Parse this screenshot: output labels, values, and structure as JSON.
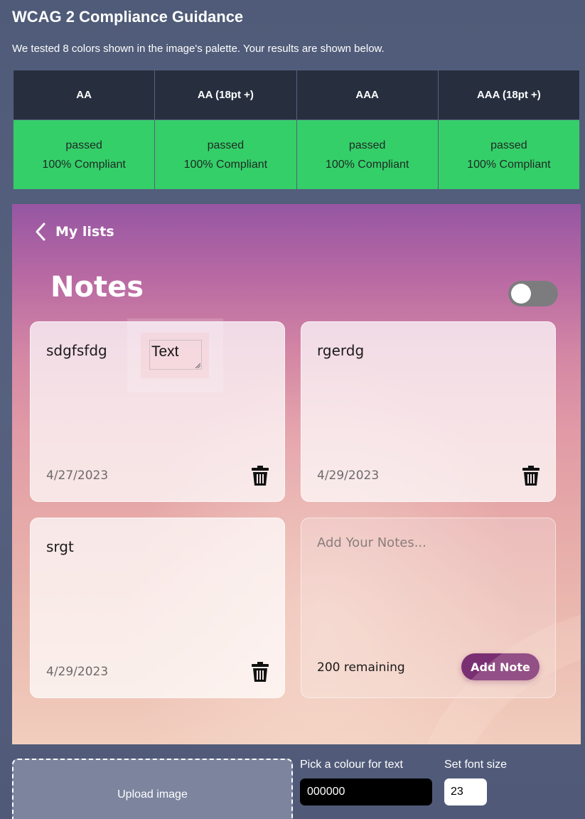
{
  "header": {
    "title": "WCAG 2 Compliance Guidance",
    "subtitle": "We tested 8 colors shown in the image's palette. Your results are shown below."
  },
  "compliance": {
    "columns": [
      "AA",
      "AA (18pt +)",
      "AAA",
      "AAA (18pt +)"
    ],
    "results": [
      {
        "status": "passed",
        "percent": "100% Compliant"
      },
      {
        "status": "passed",
        "percent": "100% Compliant"
      },
      {
        "status": "passed",
        "percent": "100% Compliant"
      },
      {
        "status": "passed",
        "percent": "100% Compliant"
      }
    ],
    "pass_color": "#35cf6a"
  },
  "preview": {
    "back_label": "My lists",
    "heading": "Notes",
    "toggle_on": false,
    "notes": [
      {
        "text": "sdgfsfdg",
        "date": "4/27/2023"
      },
      {
        "text": "rgerdg",
        "date": "4/29/2023"
      },
      {
        "text": "srgt",
        "date": "4/29/2023"
      }
    ],
    "add_card": {
      "placeholder": "Add Your Notes...",
      "remaining": "200 remaining",
      "button_label": "Add Note"
    },
    "text_widget": {
      "value": "Text"
    },
    "accent_color": "#7a2f73"
  },
  "controls": {
    "upload_label": "Upload image",
    "color_label": "Pick a colour for text",
    "color_value": "000000",
    "size_label": "Set font size",
    "size_value": "23"
  }
}
